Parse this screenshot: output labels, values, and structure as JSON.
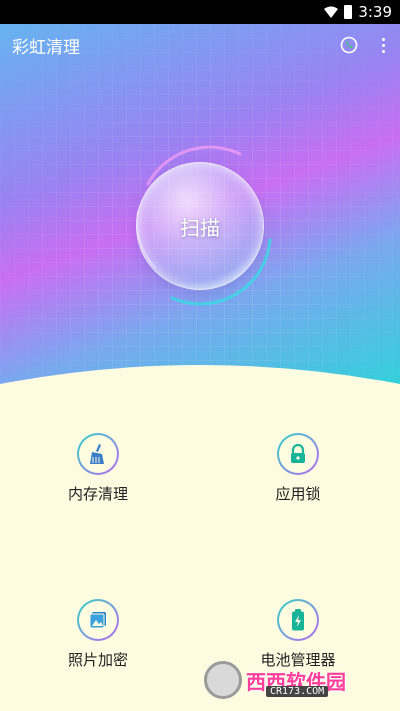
{
  "status_bar": {
    "time": "3:39"
  },
  "app_bar": {
    "title": "彩虹清理"
  },
  "scan": {
    "label": "扫描"
  },
  "features": [
    {
      "label": "内存清理",
      "icon": "broom-icon"
    },
    {
      "label": "应用锁",
      "icon": "lock-icon"
    },
    {
      "label": "照片加密",
      "icon": "photo-icon"
    },
    {
      "label": "电池管理器",
      "icon": "battery-icon"
    }
  ],
  "watermark": {
    "text": "西西软件园",
    "url": "CR173.COM"
  },
  "colors": {
    "accent_teal": "#33d3c7",
    "accent_purple": "#b86af0",
    "background": "#fdfbe0"
  }
}
